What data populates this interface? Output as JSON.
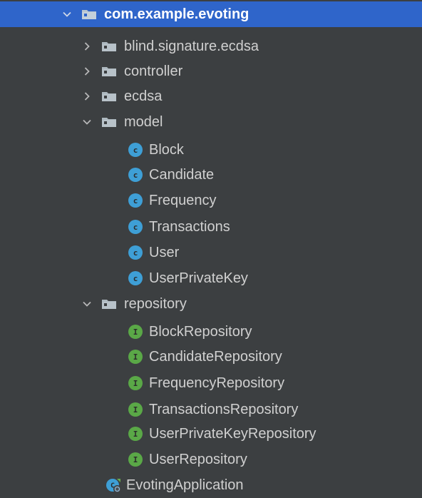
{
  "tree": {
    "root": {
      "label": "com.example.evoting",
      "icon": "folder-package-icon",
      "expanded": true
    },
    "packages": [
      {
        "label": "blind.signature.ecdsa",
        "icon": "folder-package-icon",
        "expanded": false
      },
      {
        "label": "controller",
        "icon": "folder-package-icon",
        "expanded": false
      },
      {
        "label": "ecdsa",
        "icon": "folder-package-icon",
        "expanded": false
      },
      {
        "label": "model",
        "icon": "folder-package-icon",
        "expanded": true
      },
      {
        "label": "repository",
        "icon": "folder-package-icon",
        "expanded": true
      }
    ],
    "model_classes": [
      {
        "label": "Block",
        "badge": "c"
      },
      {
        "label": "Candidate",
        "badge": "c"
      },
      {
        "label": "Frequency",
        "badge": "c"
      },
      {
        "label": "Transactions",
        "badge": "c"
      },
      {
        "label": "User",
        "badge": "c"
      },
      {
        "label": "UserPrivateKey",
        "badge": "c"
      }
    ],
    "repository_interfaces": [
      {
        "label": "BlockRepository",
        "badge": "I"
      },
      {
        "label": "CandidateRepository",
        "badge": "I"
      },
      {
        "label": "FrequencyRepository",
        "badge": "I"
      },
      {
        "label": "TransactionsRepository",
        "badge": "I"
      },
      {
        "label": "UserPrivateKeyRepository",
        "badge": "I"
      },
      {
        "label": "UserRepository",
        "badge": "I"
      }
    ],
    "application": {
      "label": "EvotingApplication",
      "icon": "spring-boot-application-icon"
    }
  },
  "colors": {
    "background": "#3c3f41",
    "selection": "#2f65ca",
    "text": "#d0d0d0",
    "class_badge": "#3e9fd6",
    "interface_badge": "#5aa847",
    "folder": "#aeb9c0"
  }
}
